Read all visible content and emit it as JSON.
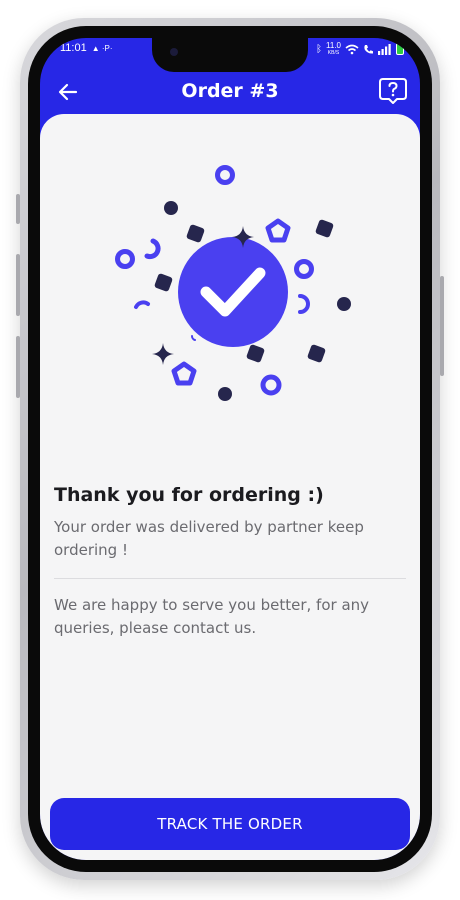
{
  "status_bar": {
    "time": "11:01",
    "indicators": "▲ ·P·",
    "net_speed_value": "11.0",
    "net_speed_unit": "KB/S"
  },
  "header": {
    "title": "Order #3",
    "back_icon": "arrow-left-icon",
    "help_icon": "help-chat-icon"
  },
  "message": {
    "title": "Thank you for ordering :)",
    "delivered": "Your order was delivered by partner keep ordering !",
    "support": "We are happy to serve you better, for any queries, please contact us."
  },
  "actions": {
    "track_label": "TRACK THE ORDER"
  },
  "colors": {
    "brand": "#2727e6",
    "accent": "#4a40f0",
    "dark_shape": "#26264d",
    "card_bg": "#f5f5f6",
    "title_text": "#1b1b1f",
    "body_text": "#6b6b70"
  }
}
